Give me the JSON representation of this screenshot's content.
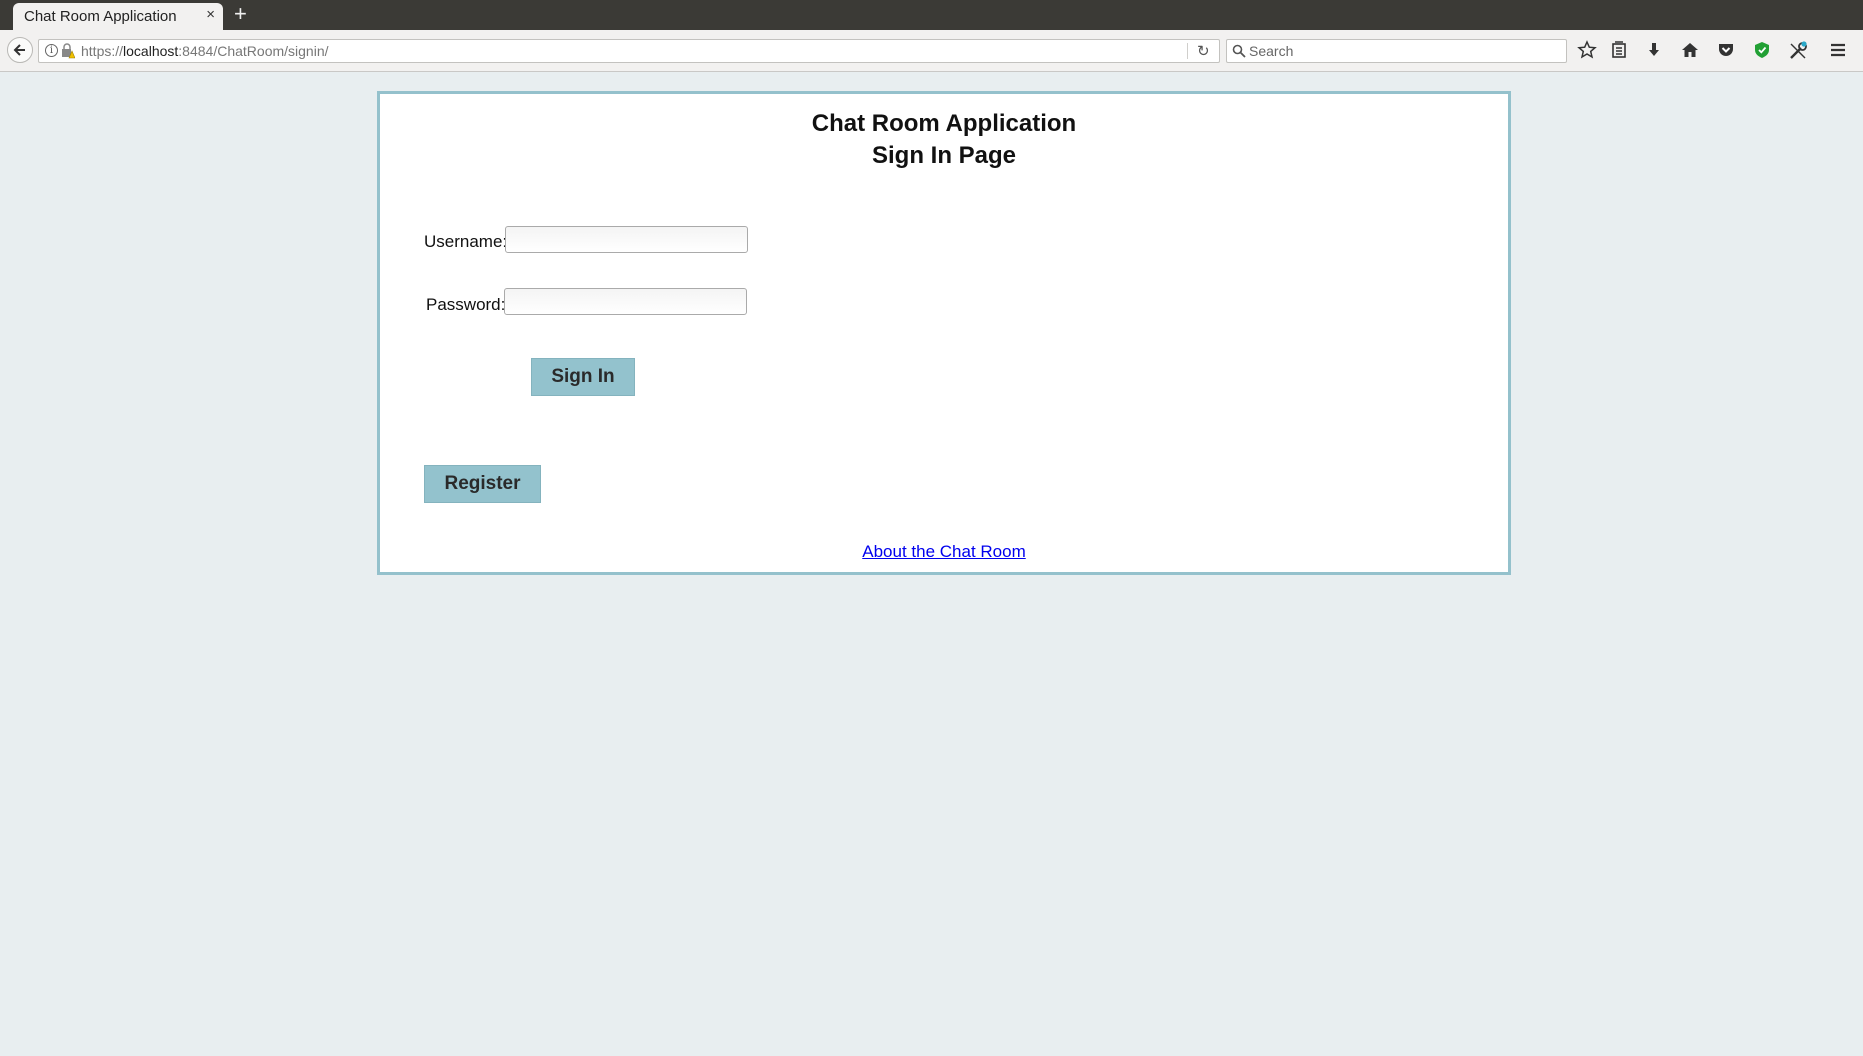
{
  "browser": {
    "tab_title": "Chat Room Application",
    "tab_close": "×",
    "new_tab": "+",
    "url_scheme": "https://",
    "url_host": "localhost",
    "url_rest": ":8484/ChatRoom/signin/",
    "search_placeholder": "Search",
    "toolbar_icons": [
      "back-icon",
      "info-icon",
      "lock-icon",
      "reload-icon",
      "search-icon",
      "bookmark-star-icon",
      "library-icon",
      "download-icon",
      "home-icon",
      "pocket-icon",
      "shield-icon",
      "tools-icon",
      "menu-icon"
    ]
  },
  "page": {
    "title_line1": "Chat Room Application",
    "title_line2": "Sign In Page",
    "username_label": "Username:",
    "username_value": "",
    "password_label": "Password:",
    "password_value": "",
    "signin_button": "Sign In",
    "register_button": "Register",
    "about_link": "About the Chat Room"
  },
  "colors": {
    "page_bg": "#e8eef0",
    "panel_border": "#94c1cc",
    "button_bg": "#93c2cd",
    "link": "#0000ee"
  }
}
